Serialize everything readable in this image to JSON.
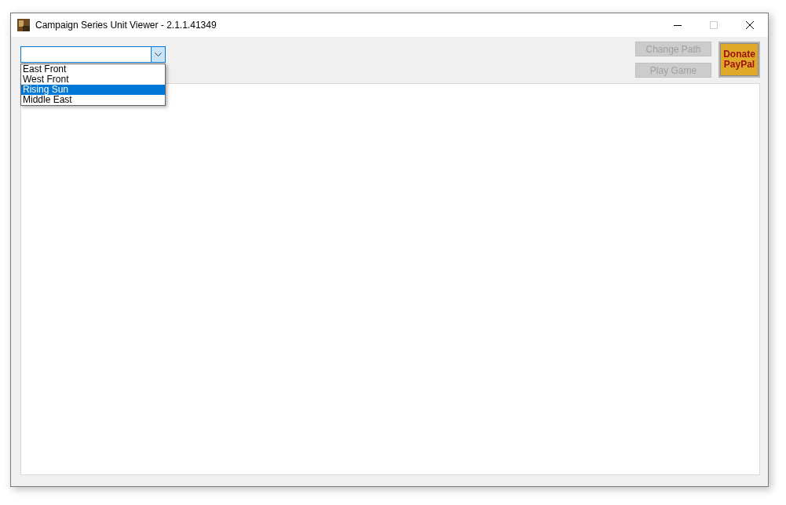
{
  "window": {
    "title": "Campaign Series Unit Viewer - 2.1.1.41349"
  },
  "combo": {
    "expanded": true,
    "options": [
      {
        "label": "East Front",
        "selected": false
      },
      {
        "label": "West Front",
        "selected": false
      },
      {
        "label": "Rising Sun",
        "selected": true
      },
      {
        "label": "Middle East",
        "selected": false
      }
    ]
  },
  "buttons": [
    {
      "label": "Change Path",
      "disabled": true
    },
    {
      "label": "Play Game",
      "disabled": true
    }
  ],
  "donate": {
    "label": "Donate PayPal"
  }
}
